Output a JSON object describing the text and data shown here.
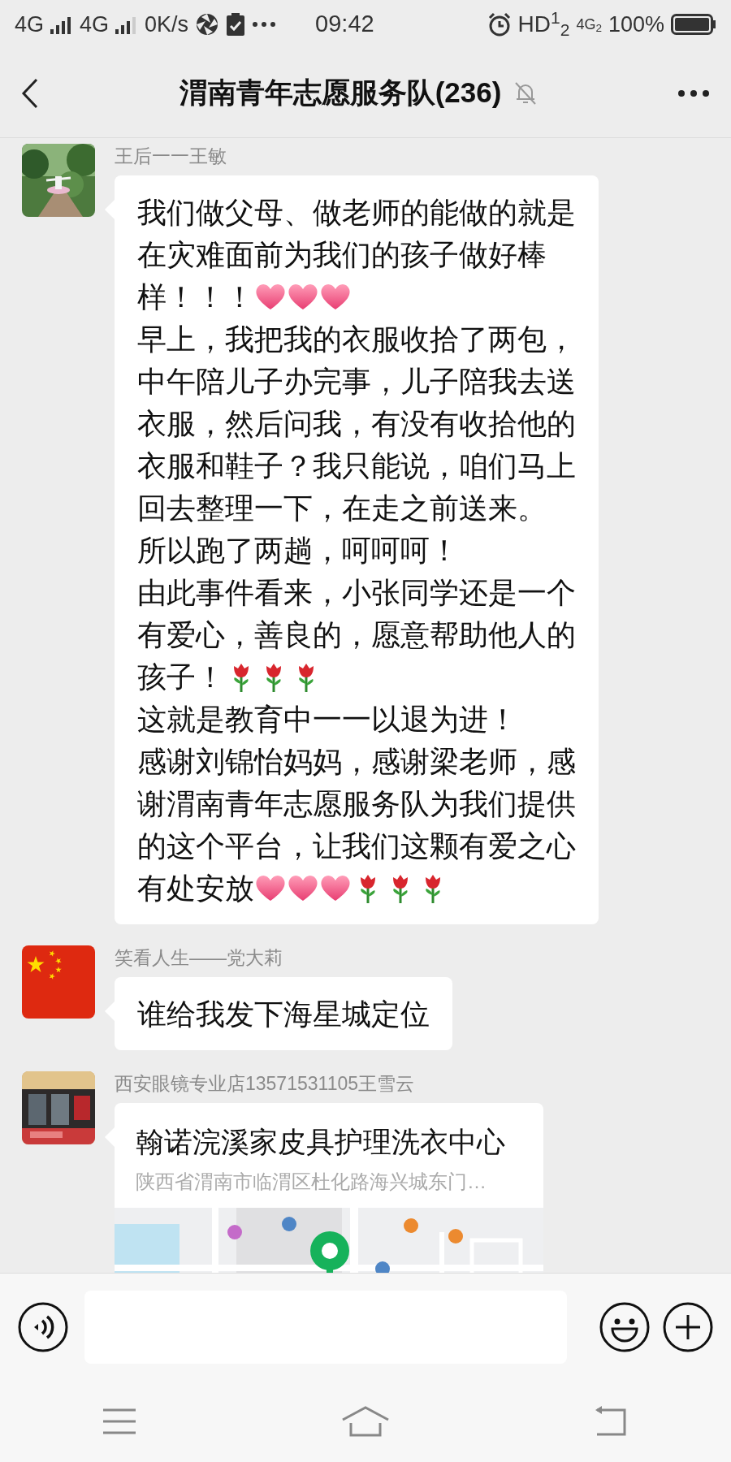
{
  "status_bar": {
    "network_1": "4G",
    "network_2": "4G",
    "speed": "0K/s",
    "time": "09:42",
    "hd": "HD$^{1}$$_{2}$",
    "network_3": "4G$_{2}$",
    "battery": "100%"
  },
  "header": {
    "title": "渭南青年志愿服务队(236)",
    "muted": true
  },
  "messages": [
    {
      "sender": "王后一一王敏",
      "kind": "text",
      "lines": [
        {
          "text": "我们做父母、做老师的能做的就是"
        },
        {
          "text": "在灾难面前为我们的孩子做好棒"
        },
        {
          "text": "样！！！",
          "icons": [
            {
              "kind": "heart"
            },
            {
              "kind": "heart"
            },
            {
              "kind": "heart"
            }
          ]
        },
        {
          "text": "早上，我把我的衣服收拾了两包，"
        },
        {
          "text": "中午陪儿子办完事，儿子陪我去送"
        },
        {
          "text": "衣服，然后问我，有没有收拾他的"
        },
        {
          "text": "衣服和鞋子？我只能说，咱们马上"
        },
        {
          "text": "回去整理一下，在走之前送来。"
        },
        {
          "text": "所以跑了两趟，呵呵呵！"
        },
        {
          "text": "由此事件看来，小张同学还是一个"
        },
        {
          "text": "有爱心，善良的，愿意帮助他人的"
        },
        {
          "text": "孩子！",
          "icons": [
            {
              "kind": "rose"
            },
            {
              "kind": "rose"
            },
            {
              "kind": "rose"
            }
          ]
        },
        {
          "text": "这就是教育中一一以退为进！"
        },
        {
          "text": "感谢刘锦怡妈妈，感谢梁老师，感"
        },
        {
          "text": "谢渭南青年志愿服务队为我们提供"
        },
        {
          "text": "的这个平台，让我们这颗有爱之心"
        },
        {
          "text": "有处安放",
          "icons": [
            {
              "kind": "heart"
            },
            {
              "kind": "heart"
            },
            {
              "kind": "heart"
            },
            {
              "kind": "rose"
            },
            {
              "kind": "rose"
            },
            {
              "kind": "rose"
            }
          ]
        }
      ]
    },
    {
      "sender": "笑看人生——党大莉",
      "avatar": {
        "kind": "flag"
      },
      "kind": "text",
      "lines": [
        {
          "text": "谁给我发下海星城定位"
        }
      ]
    },
    {
      "sender": "西安眼镜专业店13571531105王雪云",
      "kind": "location",
      "title": "翰诺浣溪家皮具护理洗衣中心",
      "address": "陕西省渭南市临渭区杜化路海兴城东门…"
    }
  ]
}
